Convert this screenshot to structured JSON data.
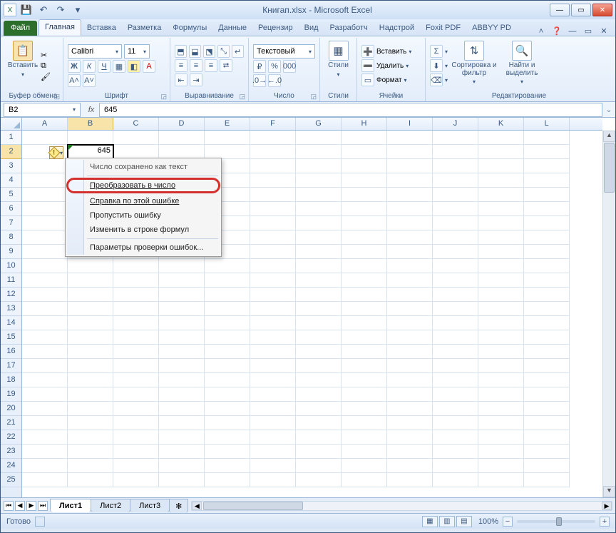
{
  "window": {
    "title": "Книгап.xlsx - Microsoft Excel"
  },
  "qat": {
    "save": "💾",
    "undo": "↶",
    "redo": "↷"
  },
  "tabs": {
    "file": "Файл",
    "items": [
      "Главная",
      "Вставка",
      "Разметка",
      "Формулы",
      "Данные",
      "Рецензир",
      "Вид",
      "Разработч",
      "Надстрой",
      "Foxit PDF",
      "ABBYY PD"
    ],
    "active": 0
  },
  "ribbon": {
    "clipboard": {
      "label": "Буфер обмена",
      "paste": "Вставить"
    },
    "font": {
      "label": "Шрифт",
      "name": "Calibri",
      "size": "11",
      "bold": "Ж",
      "italic": "К",
      "underline": "Ч"
    },
    "align": {
      "label": "Выравнивание"
    },
    "number": {
      "label": "Число",
      "format": "Текстовый",
      "currency": "₽",
      "percent": "%"
    },
    "styles": {
      "label": "Стили",
      "btn": "Стили"
    },
    "cells": {
      "label": "Ячейки",
      "insert": "Вставить",
      "delete": "Удалить",
      "format": "Формат"
    },
    "editing": {
      "label": "Редактирование",
      "sort": "Сортировка и фильтр",
      "find": "Найти и выделить"
    }
  },
  "fx": {
    "name": "B2",
    "value": "645"
  },
  "cols": [
    "A",
    "B",
    "C",
    "D",
    "E",
    "F",
    "G",
    "H",
    "I",
    "J",
    "K",
    "L"
  ],
  "cell": {
    "value": "645"
  },
  "error_menu": {
    "header": "Число сохранено как текст",
    "convert": "Преобразовать в число",
    "help": "Справка по этой ошибке",
    "ignore": "Пропустить ошибку",
    "edit": "Изменить в строке формул",
    "options": "Параметры проверки ошибок..."
  },
  "sheets": {
    "s1": "Лист1",
    "s2": "Лист2",
    "s3": "Лист3"
  },
  "status": {
    "ready": "Готово",
    "zoom": "100%"
  }
}
